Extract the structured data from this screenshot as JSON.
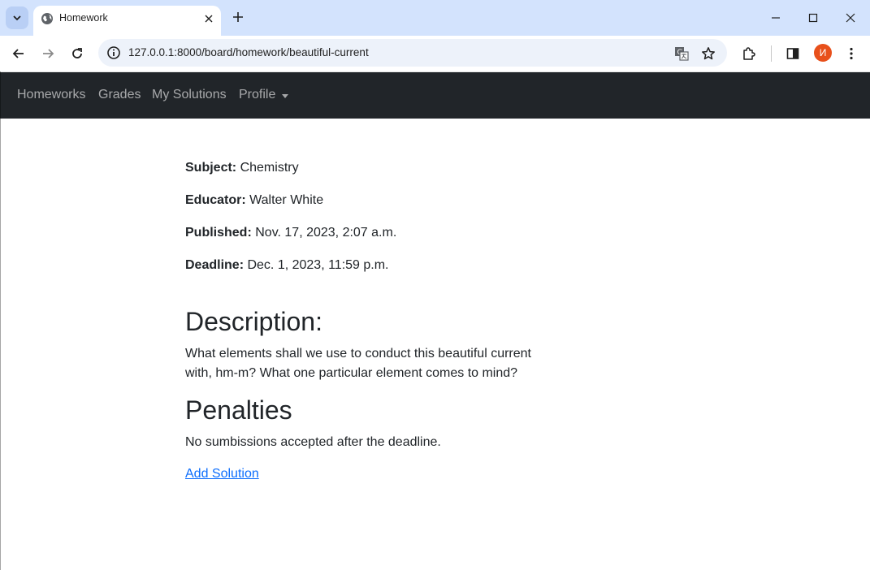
{
  "browser": {
    "tab_title": "Homework",
    "url": "127.0.0.1:8000/board/homework/beautiful-current",
    "profile_initial": "И"
  },
  "navbar": {
    "items": [
      {
        "label": "Homeworks"
      },
      {
        "label": "Grades"
      },
      {
        "label": "My Solutions"
      },
      {
        "label": "Profile"
      }
    ]
  },
  "homework": {
    "subject_label": "Subject:",
    "subject": "Chemistry",
    "educator_label": "Educator:",
    "educator": "Walter White",
    "published_label": "Published:",
    "published": "Nov. 17, 2023, 2:07 a.m.",
    "deadline_label": "Deadline:",
    "deadline": "Dec. 1, 2023, 11:59 p.m.",
    "description_heading": "Description:",
    "description": "What elements shall we use to conduct this beautiful current with, hm-m? What one particular element comes to mind?",
    "penalties_heading": "Penalties",
    "penalties": "No sumbissions accepted after the deadline.",
    "add_solution": "Add Solution"
  }
}
